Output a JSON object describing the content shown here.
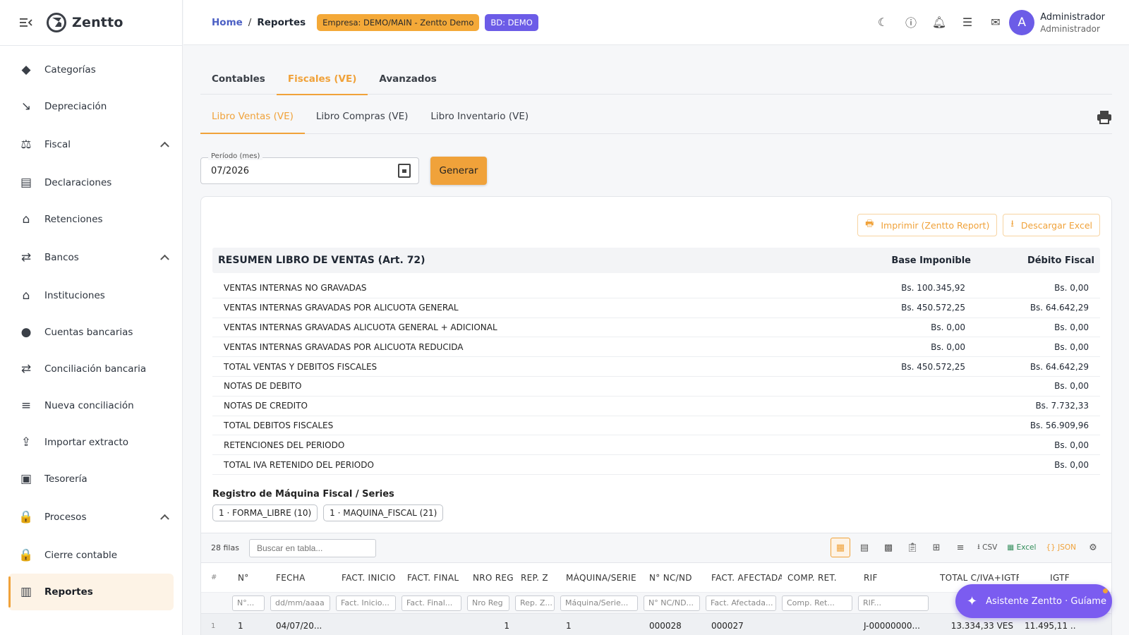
{
  "app": {
    "brand": "Zentto"
  },
  "sidebar": {
    "items": [
      {
        "label": "Categorías",
        "icon": "category-icon",
        "glyph": "◆",
        "group": false
      },
      {
        "label": "Depreciación",
        "icon": "trending-down-icon",
        "glyph": "↘",
        "group": false
      },
      {
        "label": "Fiscal",
        "icon": "gavel-icon",
        "glyph": "⚖",
        "group": true
      },
      {
        "label": "Declaraciones",
        "icon": "document-icon",
        "glyph": "▤",
        "group": false
      },
      {
        "label": "Retenciones",
        "icon": "bank-icon",
        "glyph": "⌂",
        "group": false
      },
      {
        "label": "Bancos",
        "icon": "compare-arrows-icon",
        "glyph": "⇄",
        "group": true
      },
      {
        "label": "Instituciones",
        "icon": "institution-icon",
        "glyph": "⌂",
        "group": false
      },
      {
        "label": "Cuentas bancarias",
        "icon": "piggy-bank-icon",
        "glyph": "●",
        "group": false
      },
      {
        "label": "Conciliación bancaria",
        "icon": "compare-arrows-icon",
        "glyph": "⇄",
        "group": false
      },
      {
        "label": "Nueva conciliación",
        "icon": "playlist-check-icon",
        "glyph": "≡",
        "group": false
      },
      {
        "label": "Importar extracto",
        "icon": "upload-file-icon",
        "glyph": "⇪",
        "group": false
      },
      {
        "label": "Tesorería",
        "icon": "wallet-icon",
        "glyph": "▣",
        "group": false
      },
      {
        "label": "Procesos",
        "icon": "lock-icon",
        "glyph": "🔒",
        "group": true
      },
      {
        "label": "Cierre contable",
        "icon": "lock-icon",
        "glyph": "🔒",
        "group": false
      },
      {
        "label": "Reportes",
        "icon": "bar-chart-icon",
        "glyph": "▥",
        "group": false,
        "active": true
      }
    ]
  },
  "header": {
    "breadcrumb_home": "Home",
    "breadcrumb_sep": "/",
    "breadcrumb_current": "Reportes",
    "company_chip": "Empresa: DEMO/MAIN - Zentto Demo",
    "db_chip": "BD: DEMO",
    "user_initial": "A",
    "user_name": "Administrador",
    "user_role": "Administrador"
  },
  "tabs_main": [
    "Contables",
    "Fiscales (VE)",
    "Avanzados"
  ],
  "tabs_sub": [
    "Libro Ventas (VE)",
    "Libro Compras (VE)",
    "Libro Inventario (VE)"
  ],
  "filters": {
    "period_label": "Período (mes)",
    "period_value": "07/2026",
    "generate_label": "Generar"
  },
  "actions": {
    "print_label": "Imprimir (Zentto Report)",
    "excel_label": "Descargar Excel"
  },
  "summary": {
    "title": "RESUMEN LIBRO DE VENTAS (Art. 72)",
    "col_base": "Base Imponible",
    "col_debit": "Débito Fiscal",
    "rows": [
      {
        "label": "VENTAS INTERNAS NO GRAVADAS",
        "base": "Bs. 100.345,92",
        "debit": "Bs. 0,00"
      },
      {
        "label": "VENTAS INTERNAS GRAVADAS POR ALICUOTA GENERAL",
        "base": "Bs. 450.572,25",
        "debit": "Bs. 64.642,29"
      },
      {
        "label": "VENTAS INTERNAS GRAVADAS ALICUOTA GENERAL + ADICIONAL",
        "base": "Bs. 0,00",
        "debit": "Bs. 0,00"
      },
      {
        "label": "VENTAS INTERNAS GRAVADAS POR ALICUOTA REDUCIDA",
        "base": "Bs. 0,00",
        "debit": "Bs. 0,00"
      },
      {
        "label": "TOTAL VENTAS Y DEBITOS FISCALES",
        "base": "Bs. 450.572,25",
        "debit": "Bs. 64.642,29"
      },
      {
        "label": "NOTAS DE DEBITO",
        "base": "",
        "debit": "Bs. 0,00"
      },
      {
        "label": "NOTAS DE CREDITO",
        "base": "",
        "debit": "Bs. 7.732,33"
      },
      {
        "label": "TOTAL DEBITOS FISCALES",
        "base": "",
        "debit": "Bs. 56.909,96"
      },
      {
        "label": "RETENCIONES DEL PERIODO",
        "base": "",
        "debit": "Bs. 0,00"
      },
      {
        "label": "TOTAL IVA RETENIDO DEL PERIODO",
        "base": "",
        "debit": "Bs. 0,00"
      }
    ]
  },
  "machines": {
    "title": "Registro de Máquina Fiscal / Series",
    "chips": [
      "1 · FORMA_LIBRE (10)",
      "1 · MAQUINA_FISCAL (21)"
    ]
  },
  "grid": {
    "row_count": "28 filas",
    "search_placeholder": "Buscar en tabla...",
    "toolbar": {
      "csv": "CSV",
      "excel": "Excel",
      "json": "JSON"
    },
    "columns": [
      "#",
      "N°",
      "FECHA",
      "FACT. INICIO",
      "FACT. FINAL",
      "NRO REG",
      "REP. Z",
      "MÁQUINA/SERIE",
      "N° NC/ND",
      "FACT. AFECTADA",
      "COMP. RET.",
      "RIF",
      "TOTAL C/IVA+IGTF",
      "IGTF"
    ],
    "filters": [
      "N°...",
      "dd/mm/aaaa",
      "Fact. Inicio...",
      "Fact. Final...",
      "Nro Reg",
      "Rep. Z...",
      "Máquina/Serie...",
      "N° NC/ND...",
      "Fact. Afectada...",
      "Comp. Ret...",
      "RIF..."
    ],
    "rows": [
      [
        "1",
        "1",
        "04/07/20...",
        "",
        "",
        "1",
        "",
        "1",
        "000028",
        "000027",
        "",
        "J-00000000...",
        "13.334,33 VES",
        "11.495,11 ..."
      ]
    ]
  },
  "assistant": {
    "label": "Asistente Zentto · Guíame"
  }
}
